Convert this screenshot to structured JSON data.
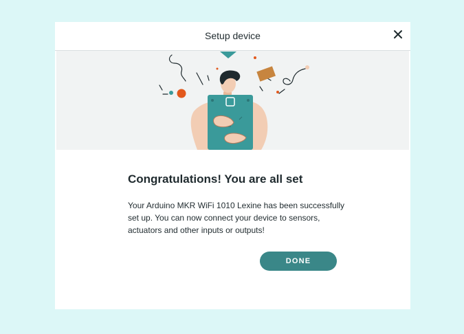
{
  "dialog": {
    "title": "Setup device",
    "close_icon": "close-icon",
    "heading": "Congratulations! You are all set",
    "message": "Your Arduino MKR WiFi 1010 Lexine has been successfully set up. You can now connect your device to sensors, actuators and other inputs or outputs!",
    "done_label": "DONE"
  },
  "illustration": {
    "name": "person-holding-board-illustration"
  },
  "colors": {
    "page_background": "#dcf7f7",
    "accent_teal": "#3a8788",
    "skin": "#f2cdb4",
    "hero_background": "#f1f3f3",
    "confetti_orange": "#e2581c",
    "confetti_brown": "#c7853f"
  }
}
